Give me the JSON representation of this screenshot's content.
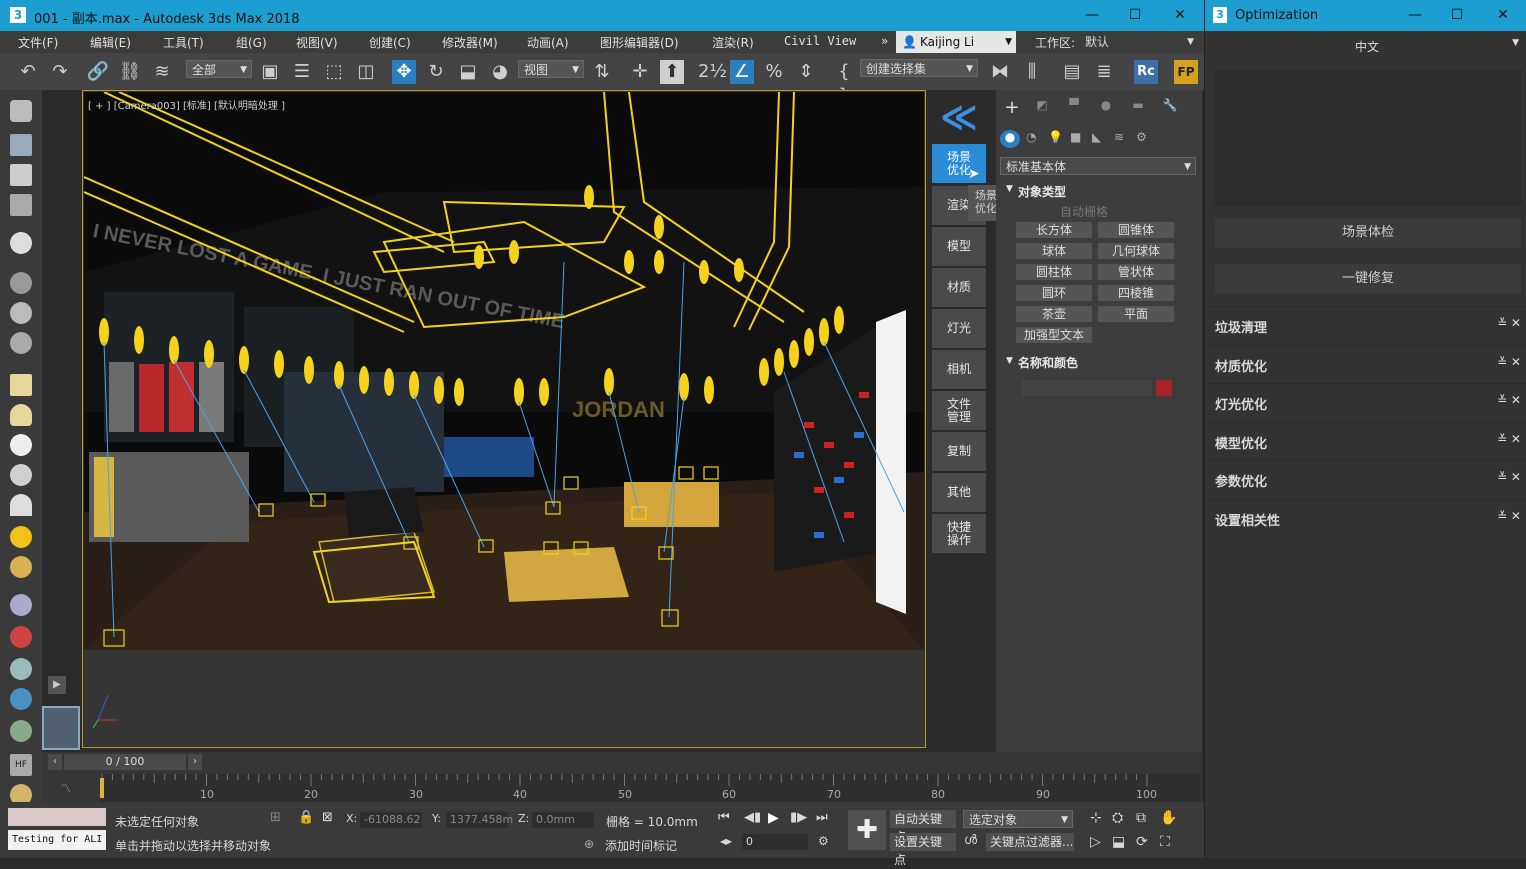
{
  "main_window": {
    "title": "001 - 副本.max - Autodesk 3ds Max 2018",
    "app_icon": "3",
    "controls": {
      "minimize": "—",
      "maximize": "☐",
      "close": "✕"
    }
  },
  "menu": {
    "items": [
      "文件(F)",
      "编辑(E)",
      "工具(T)",
      "组(G)",
      "视图(V)",
      "创建(C)",
      "修改器(M)",
      "动画(A)",
      "图形编辑器(D)",
      "渲染(R)",
      "Civil View"
    ],
    "overflow": "»",
    "user": "Kaijing Li",
    "workspace_label": "工作区:",
    "workspace_value": "默认"
  },
  "toolbar": {
    "filter_value": "全部",
    "view_value": "视图",
    "selection_set_placeholder": "创建选择集",
    "rc_label": "Rc",
    "fp_label": "FP"
  },
  "viewport": {
    "label": "[ + ] [Camera003] [标准] [默认明暗处理 ]",
    "wall_text": "I NEVER LOST A GAME. I JUST RAN OUT OF TIME",
    "sign_text": "JORDAN"
  },
  "optimization_sidebar": {
    "items": [
      "场景\n优化",
      "渲染",
      "模型",
      "材质",
      "灯光",
      "相机",
      "文件\n管理",
      "复制",
      "其他",
      "快捷\n操作"
    ],
    "tooltip": "场景\n优化"
  },
  "command_panel": {
    "category_value": "标准基本体",
    "object_type_title": "对象类型",
    "autogrid": "自动栅格",
    "buttons": [
      "长方体",
      "圆锥体",
      "球体",
      "几何球体",
      "圆柱体",
      "管状体",
      "圆环",
      "四棱锥",
      "茶壶",
      "平面"
    ],
    "extended_text": "加强型文本",
    "name_color_title": "名称和颜色",
    "color_swatch": "#a8232a"
  },
  "optimization_window": {
    "title": "Optimization",
    "lang": "中文",
    "btn_check": "场景体检",
    "btn_fix": "一键修复",
    "sections": [
      "垃圾清理",
      "材质优化",
      "灯光优化",
      "模型优化",
      "参数优化",
      "设置相关性"
    ]
  },
  "timeline": {
    "frame_display": "0 / 100",
    "ticks": [
      "10",
      "20",
      "30",
      "40",
      "50",
      "60",
      "70",
      "80",
      "90",
      "100"
    ]
  },
  "status": {
    "script_box": "Testing for ALI",
    "selection_msg": "未选定任何对象",
    "hint_msg": "单击并拖动以选择并移动对象",
    "x_label": "X:",
    "x_value": "-61088.62",
    "y_label": "Y:",
    "y_value": "1377.458m",
    "z_label": "Z:",
    "z_value": "0.0mm",
    "grid": "栅格 = 10.0mm",
    "add_time_tag": "添加时间标记",
    "auto_key": "自动关键点",
    "set_key": "设置关键点",
    "selected_obj": "选定对象",
    "key_filters": "关键点过滤器...",
    "frame_spinner": "0"
  }
}
